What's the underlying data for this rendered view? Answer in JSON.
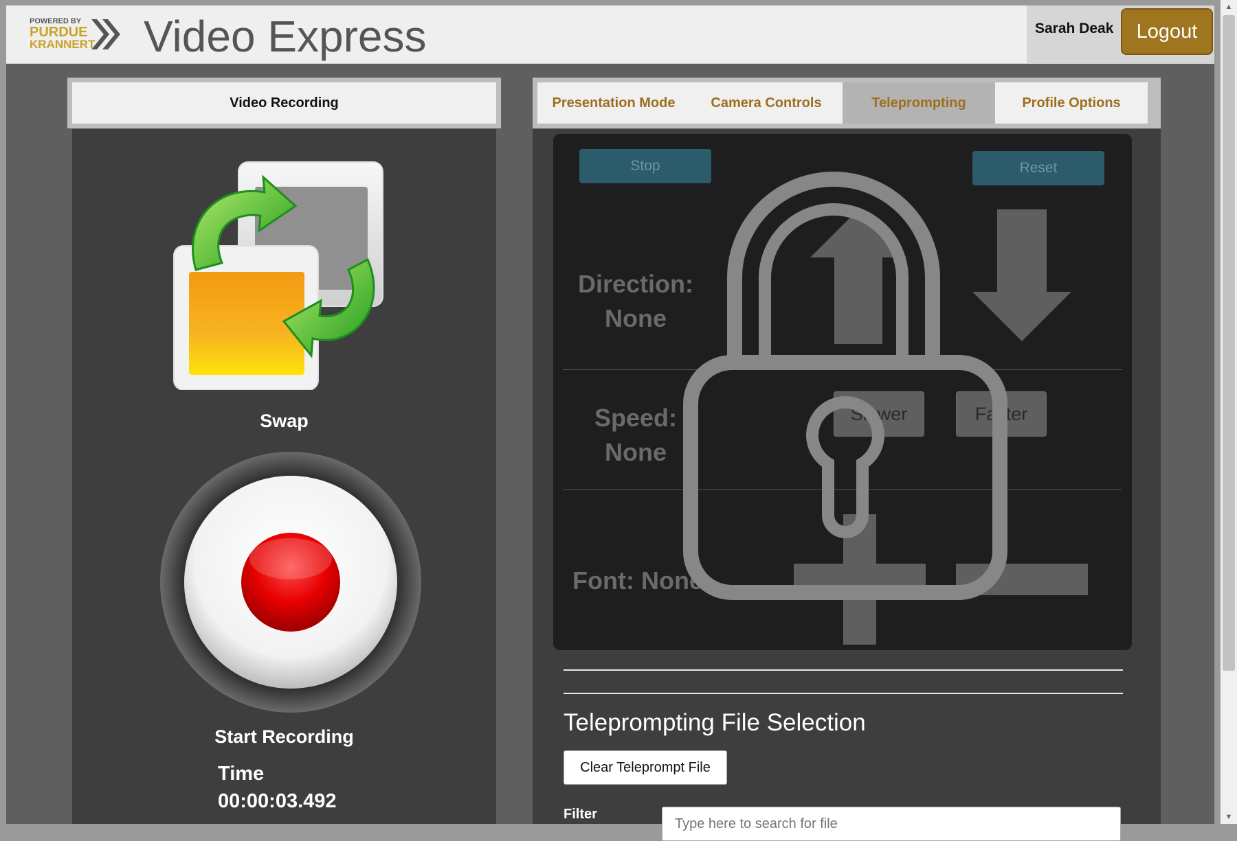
{
  "header": {
    "logo": {
      "line1": "POWERED BY",
      "line2": "PURDUE",
      "line3": "KRANNERT"
    },
    "title": "Video Express",
    "user_name": "Sarah Deak",
    "logout_label": "Logout"
  },
  "left_panel": {
    "tab_label": "Video Recording",
    "swap_label": "Swap",
    "record_label": "Start Recording",
    "time_label": "Time",
    "time_value": "00:00:03.492"
  },
  "tabs": [
    {
      "label": "Presentation Mode",
      "active": false
    },
    {
      "label": "Camera Controls",
      "active": false
    },
    {
      "label": "Teleprompting",
      "active": true
    },
    {
      "label": "Profile Options",
      "active": false
    }
  ],
  "teleprompter": {
    "stop_label": "Stop",
    "reset_label": "Reset",
    "direction_label": "Direction:",
    "direction_value": "None",
    "speed_label": "Speed:",
    "speed_value": "None",
    "slower_label": "Slower",
    "faster_label": "Faster",
    "font_label": "Font: None",
    "locked": true
  },
  "file_selection": {
    "title": "Teleprompting File Selection",
    "clear_label": "Clear Teleprompt File",
    "filter_label": "Filter",
    "filter_placeholder": "Type here to search for file"
  },
  "colors": {
    "accent": "#a07520",
    "tab_text": "#9c6f1e",
    "teal_button": "#2c5b6b"
  }
}
